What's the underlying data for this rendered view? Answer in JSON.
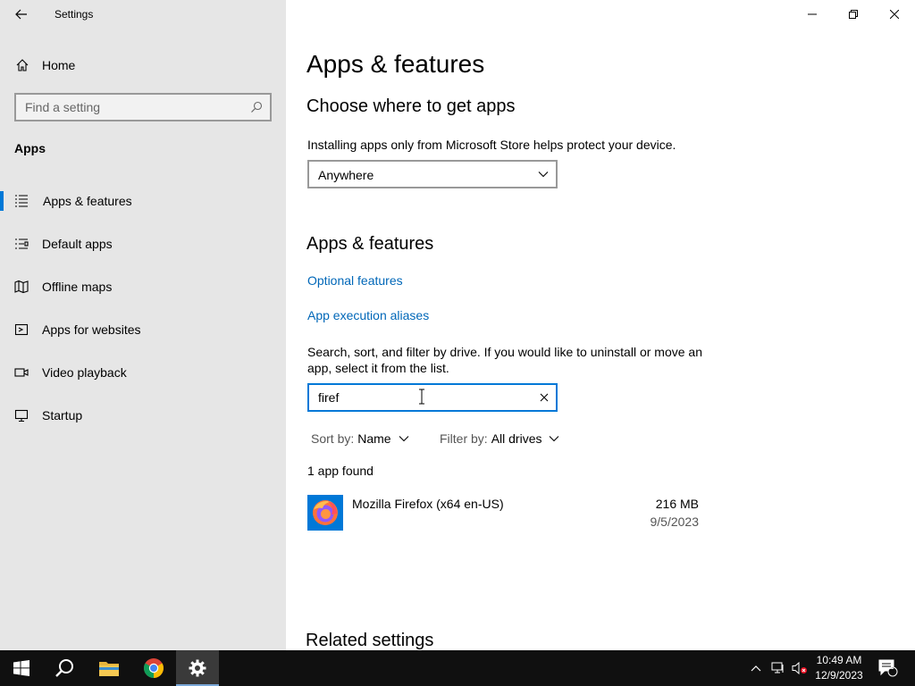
{
  "window": {
    "title": "Settings"
  },
  "sidebar": {
    "home_label": "Home",
    "search_placeholder": "Find a setting",
    "section": "Apps",
    "items": [
      {
        "label": "Apps & features",
        "icon": "apps-features-icon",
        "active": true
      },
      {
        "label": "Default apps",
        "icon": "default-apps-icon"
      },
      {
        "label": "Offline maps",
        "icon": "map-icon"
      },
      {
        "label": "Apps for websites",
        "icon": "apps-websites-icon"
      },
      {
        "label": "Video playback",
        "icon": "video-icon"
      },
      {
        "label": "Startup",
        "icon": "startup-icon"
      }
    ]
  },
  "main": {
    "page_title": "Apps & features",
    "choose_heading": "Choose where to get apps",
    "choose_desc": "Installing apps only from Microsoft Store helps protect your device.",
    "source_dropdown": "Anywhere",
    "features_heading": "Apps & features",
    "link_optional": "Optional features",
    "link_aliases": "App execution aliases",
    "search_desc": "Search, sort, and filter by drive. If you would like to uninstall or move an app, select it from the list.",
    "search_value": "firef",
    "sort_label": "Sort by:",
    "sort_value": "Name",
    "filter_label": "Filter by:",
    "filter_value": "All drives",
    "found_text": "1 app found",
    "apps": [
      {
        "name": "Mozilla Firefox (x64 en-US)",
        "size": "216 MB",
        "date": "9/5/2023"
      }
    ],
    "related_heading": "Related settings"
  },
  "taskbar": {
    "time": "10:49 AM",
    "date": "12/9/2023",
    "notification_count": "1"
  },
  "colors": {
    "accent": "#0078d7",
    "link": "#0067b8",
    "sidebar_bg": "#e6e6e6",
    "taskbar_bg": "#101010"
  }
}
